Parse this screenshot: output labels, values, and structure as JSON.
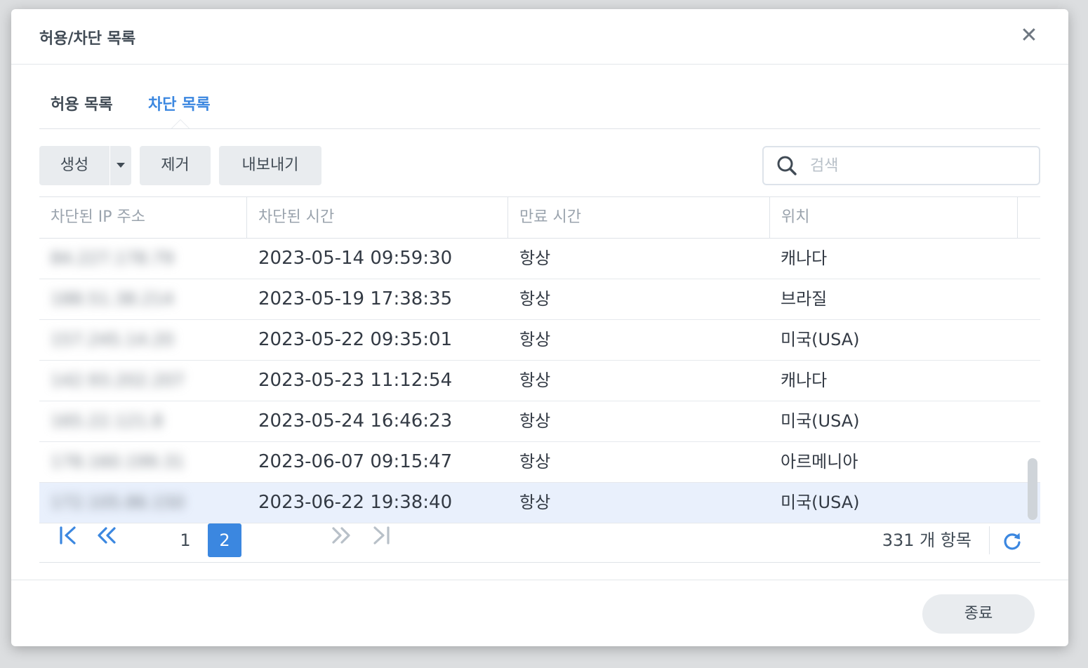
{
  "window": {
    "title": "허용/차단 목록",
    "close_symbol": "✕"
  },
  "tabs": [
    {
      "label": "허용 목록",
      "active": false
    },
    {
      "label": "차단 목록",
      "active": true
    }
  ],
  "toolbar": {
    "create_label": "생성",
    "remove_label": "제거",
    "export_label": "내보내기",
    "search_placeholder": "검색"
  },
  "table": {
    "columns": [
      "차단된 IP 주소",
      "차단된 시간",
      "만료 시간",
      "위치"
    ],
    "rows": [
      {
        "ip": "84.227.178.79",
        "time": "2023-05-14 09:59:30",
        "expire": "항상",
        "location": "캐나다"
      },
      {
        "ip": "188.51.38.214",
        "time": "2023-05-19 17:38:35",
        "expire": "항상",
        "location": "브라질"
      },
      {
        "ip": "157.245.14.20",
        "time": "2023-05-22 09:35:01",
        "expire": "항상",
        "location": "미국(USA)"
      },
      {
        "ip": "142.93.202.207",
        "time": "2023-05-23 11:12:54",
        "expire": "항상",
        "location": "캐나다"
      },
      {
        "ip": "165.22.121.8",
        "time": "2023-05-24 16:46:23",
        "expire": "항상",
        "location": "미국(USA)"
      },
      {
        "ip": "178.160.199.31",
        "time": "2023-06-07 09:15:47",
        "expire": "항상",
        "location": "아르메니아"
      },
      {
        "ip": "172.105.86.150",
        "time": "2023-06-22 19:38:40",
        "expire": "항상",
        "location": "미국(USA)"
      }
    ],
    "selected_row": 6
  },
  "pager": {
    "first_symbol": "|<",
    "prev_symbol": "«",
    "pages": [
      "1",
      "2"
    ],
    "current_page": "2",
    "next_symbol": "»",
    "last_symbol": ">|",
    "count_label": "331 개 항목"
  },
  "footer": {
    "close_label": "종료"
  },
  "colors": {
    "accent": "#3b87e0",
    "selected_row": "#e9f0fc",
    "button_bg": "#e9ecef"
  }
}
